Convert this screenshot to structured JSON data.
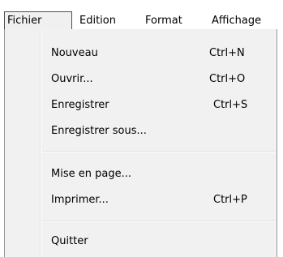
{
  "menubar": {
    "items": [
      {
        "label": "Fichier"
      },
      {
        "label": "Edition"
      },
      {
        "label": "Format"
      },
      {
        "label": "Affichage"
      }
    ]
  },
  "menu": {
    "items": [
      {
        "label": "Nouveau",
        "shortcut": "Ctrl+N"
      },
      {
        "label": "Ouvrir...",
        "shortcut": "Ctrl+O"
      },
      {
        "label": "Enregistrer",
        "shortcut": "Ctrl+S"
      },
      {
        "label": "Enregistrer sous...",
        "shortcut": ""
      },
      {
        "label": "Mise en page...",
        "shortcut": ""
      },
      {
        "label": "Imprimer...",
        "shortcut": "Ctrl+P"
      },
      {
        "label": "Quitter",
        "shortcut": ""
      }
    ]
  }
}
